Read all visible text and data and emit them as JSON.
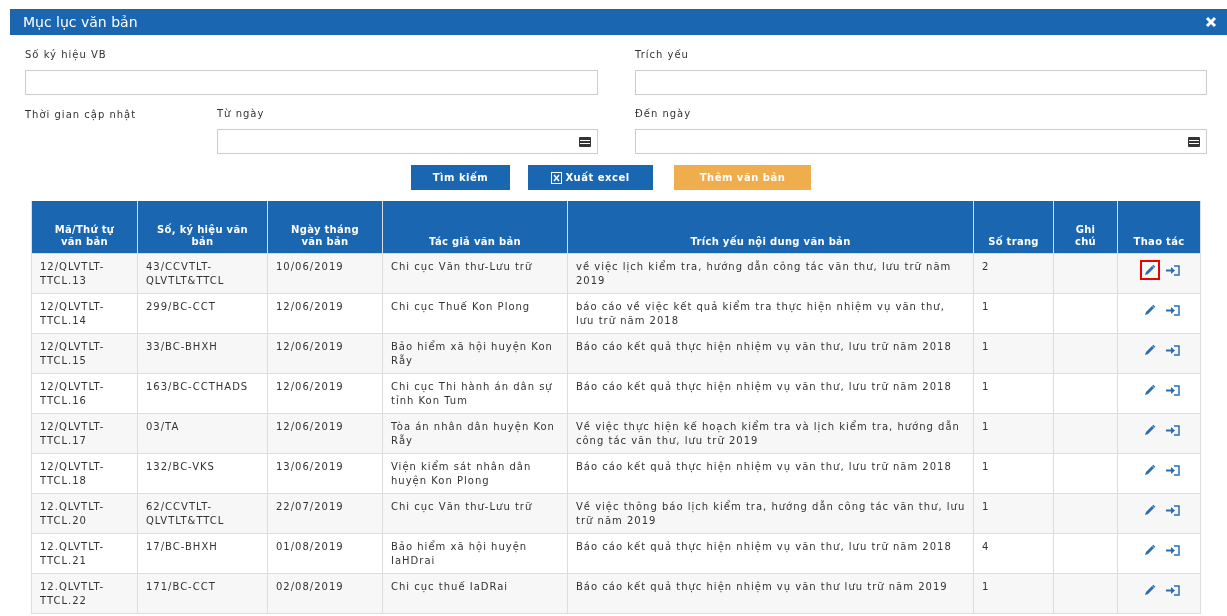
{
  "window": {
    "title": "Mục lục văn bản"
  },
  "filters": {
    "fields": [
      {
        "label": "Số ký hiệu VB",
        "kind": "text"
      },
      {
        "label": "Trích yếu",
        "kind": "text"
      }
    ],
    "date_range": {
      "label": "Thời gian cập nhật",
      "fields": [
        {
          "label": "Từ ngày",
          "kind": "date"
        },
        {
          "label": "Đến ngày",
          "kind": "date"
        }
      ]
    }
  },
  "buttons": [
    {
      "label": "Tìm kiếm",
      "kind": "primary"
    },
    {
      "label": "Xuất excel",
      "kind": "export"
    },
    {
      "label": "Thêm văn bản",
      "kind": "warning"
    }
  ],
  "table": {
    "columns": [
      "Mã/Thứ tự văn bản",
      "Số, ký hiệu văn bản",
      "Ngày tháng văn bản",
      "Tác giả văn bản",
      "Trích yếu nội dung văn bản",
      "Số trang",
      "Ghi chú",
      "Thao tác"
    ],
    "rows": [
      {
        "cells": [
          "12/QLVTLT-TTCL.13",
          "43/CCVTLT-QLVTLT&TTCL",
          "10/06/2019",
          "Chi cục Văn thư-Lưu trữ",
          "về việc lịch kiểm tra, hướng dẫn công tác văn thư, lưu trữ năm 2019",
          "2"
        ],
        "edit_highlighted": true
      },
      {
        "cells": [
          "12/QLVTLT-TTCL.14",
          "299/BC-CCT",
          "12/06/2019",
          "Chi cục Thuế Kon Plong",
          "báo cáo về việc kết quả kiểm tra thực hiện nhiệm vụ văn thư, lưu trữ năm 2018",
          "1"
        ],
        "edit_highlighted": false
      },
      {
        "cells": [
          "12/QLVTLT-TTCL.15",
          "33/BC-BHXH",
          "12/06/2019",
          "Bảo hiểm xã hội huyện Kon Rẫy",
          "Báo cáo kết quả thực hiện nhiệm vụ văn thư, lưu trữ năm 2018",
          "1"
        ],
        "edit_highlighted": false
      },
      {
        "cells": [
          "12/QLVTLT-TTCL.16",
          "163/BC-CCTHADS",
          "12/06/2019",
          "Chi cục Thi hành án dân sự tỉnh Kon Tum",
          "Báo cáo kết quả thực hiện nhiệm vụ văn thư, lưu trữ năm 2018",
          "1"
        ],
        "edit_highlighted": false
      },
      {
        "cells": [
          "12/QLVTLT-TTCL.17",
          "03/TA",
          "12/06/2019",
          "Tòa án nhân dân huyện Kon Rẫy",
          "Về việc thực hiện kế hoạch kiểm tra và lịch kiểm tra, hướng dẫn công tác văn thư, lưu trữ 2019",
          "1"
        ],
        "edit_highlighted": false
      },
      {
        "cells": [
          "12/QLVTLT-TTCL.18",
          "132/BC-VKS",
          "13/06/2019",
          "Viện kiểm sát nhân dân huyện Kon Plong",
          "Báo cáo kết quả thực hiện nhiệm vụ văn thư, lưu trữ năm 2018",
          "1"
        ],
        "edit_highlighted": false
      },
      {
        "cells": [
          "12.QLVTLT-TTCL.20",
          "62/CCVTLT-QLVTLT&TTCL",
          "22/07/2019",
          "Chi cục Văn thư-Lưu trữ",
          "Về việc thông báo lịch kiểm tra, hướng dẫn công tác văn thư, lưu trữ năm 2019",
          "1"
        ],
        "edit_highlighted": false
      },
      {
        "cells": [
          "12.QLVTLT-TTCL.21",
          "17/BC-BHXH",
          "01/08/2019",
          "Bảo hiểm xã hội huyện IaHDrai",
          "Báo cáo kết quả thực hiện nhiệm vụ văn thư, lưu trữ năm 2018",
          "4"
        ],
        "edit_highlighted": false
      },
      {
        "cells": [
          "12.QLVTLT-TTCL.22",
          "171/BC-CCT",
          "02/08/2019",
          "Chi cục thuế IaDRai",
          "Báo cáo kết quả thực hiện nhiệm vụ văn thư lưu trữ năm 2019",
          "1"
        ],
        "edit_highlighted": false
      }
    ]
  }
}
